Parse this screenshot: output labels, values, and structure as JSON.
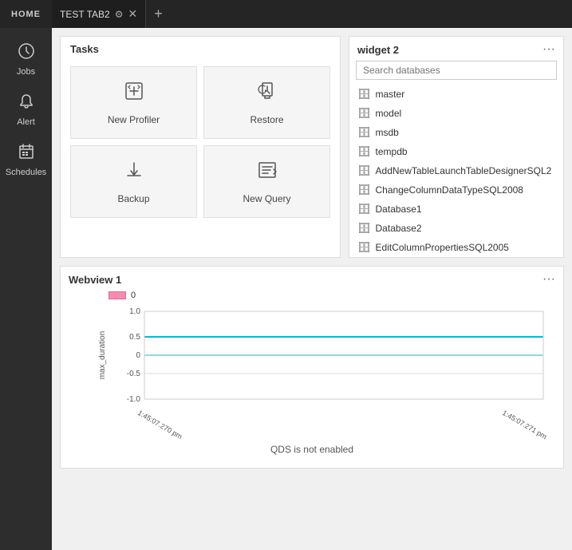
{
  "topbar": {
    "home_label": "HOME",
    "tab_label": "TEST TAB2",
    "new_tab_icon": "+"
  },
  "sidebar": {
    "items": [
      {
        "label": "Jobs",
        "icon": "⚙"
      },
      {
        "label": "Alert",
        "icon": "🔔"
      },
      {
        "label": "Schedules",
        "icon": "📅"
      }
    ]
  },
  "tasks_widget": {
    "title": "Tasks",
    "items": [
      {
        "label": "New Profiler",
        "icon": "📝"
      },
      {
        "label": "Restore",
        "icon": "🔄"
      },
      {
        "label": "Backup",
        "icon": "📤"
      },
      {
        "label": "New Query",
        "icon": "📋"
      }
    ]
  },
  "widget2": {
    "title": "widget 2",
    "search_placeholder": "Search databases",
    "databases": [
      "master",
      "model",
      "msdb",
      "tempdb",
      "AddNewTableLaunchTableDesignerSQL2",
      "ChangeColumnDataTypeSQL2008",
      "Database1",
      "Database2",
      "EditColumnPropertiesSQL2005"
    ]
  },
  "webview": {
    "title": "Webview 1",
    "legend_label": "0",
    "y_axis_label": "max_duration",
    "x_label_left": "1:45:07.270 pm",
    "x_label_right": "1:45:07.271 pm",
    "footer_text": "QDS is not enabled",
    "chart": {
      "y_ticks": [
        "1.0",
        "0.5",
        "0",
        "-0.5",
        "-1.0"
      ],
      "line_y": 0.5,
      "grid_lines": 5
    }
  }
}
